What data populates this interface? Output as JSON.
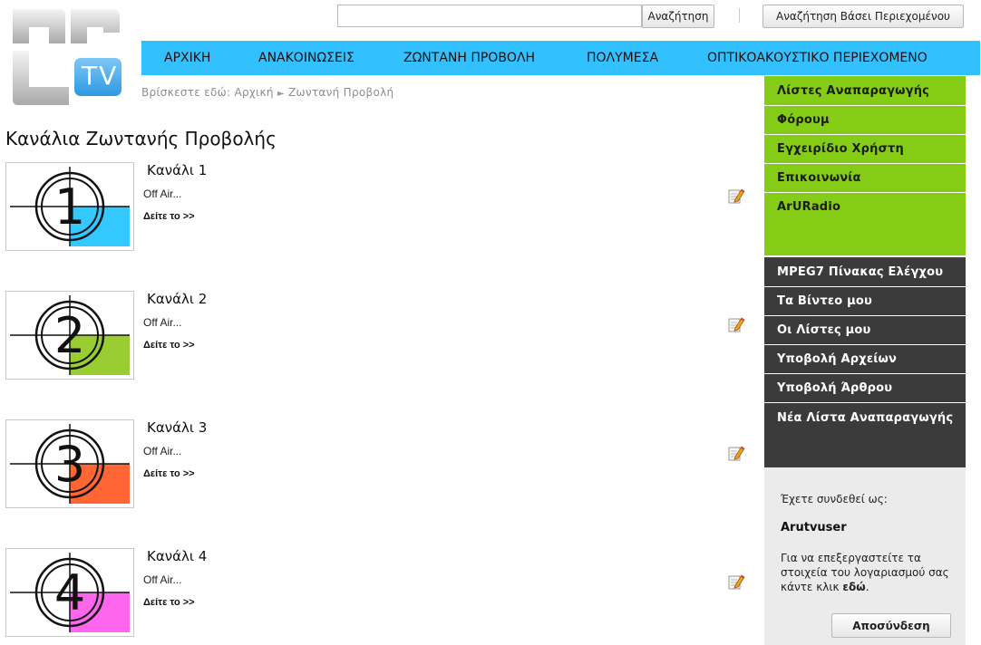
{
  "logo": {
    "text": "TV",
    "accent_color": "#3aa8ee"
  },
  "search": {
    "placeholder": "",
    "button_label": "Αναζήτηση"
  },
  "content_search": {
    "button_label": "Αναζήτηση Βάσει Περιεχομένου"
  },
  "nav": {
    "items": [
      {
        "label": "ΑΡΧΙΚΗ"
      },
      {
        "label": "ΑΝΑΚΟΙΝΩΣΕΙΣ"
      },
      {
        "label": "ΖΩΝΤΑΝΗ ΠΡΟΒΟΛΗ"
      },
      {
        "label": "ΠΟΛΥΜΕΣΑ"
      },
      {
        "label": "ΟΠΤΙΚΟΑΚΟΥΣΤΙΚΟ ΠΕΡΙΕΧΟΜΕΝΟ"
      }
    ],
    "background": "#33c0ff"
  },
  "breadcrumb": {
    "prefix": "Βρίσκεστε εδώ:",
    "home": "Αρχική",
    "separator": "►",
    "current": "Ζωντανή Προβολή"
  },
  "page_title": "Κανάλια Ζωντανής Προβολής",
  "channels": [
    {
      "number": "1",
      "name": "Κανάλι 1",
      "status": "Off Air...",
      "link": "Δείτε το >>",
      "color": "#33c8ff"
    },
    {
      "number": "2",
      "name": "Κανάλι 2",
      "status": "Off Air...",
      "link": "Δείτε το >>",
      "color": "#9acd32"
    },
    {
      "number": "3",
      "name": "Κανάλι 3",
      "status": "Off Air...",
      "link": "Δείτε το >>",
      "color": "#ff6633"
    },
    {
      "number": "4",
      "name": "Κανάλι 4",
      "status": "Off Air...",
      "link": "Δείτε το >>",
      "color": "#ff66ee"
    }
  ],
  "sidebar": {
    "green_items": [
      {
        "label": "Λίστες Αναπαραγωγής"
      },
      {
        "label": "Φόρουμ"
      },
      {
        "label": "Εγχειρίδιο Χρήστη"
      },
      {
        "label": "Επικοινωνία"
      },
      {
        "label": "ArURadio"
      }
    ],
    "dark_items": [
      {
        "label": "MPEG7 Πίνακας Ελέγχου"
      },
      {
        "label": "Τα Βίντεο μου"
      },
      {
        "label": "Οι Λίστες μου"
      },
      {
        "label": "Υποβολή Αρχείων"
      },
      {
        "label": "Υποβολή Άρθρου"
      },
      {
        "label": "Νέα Λίστα Αναπαραγωγής"
      }
    ],
    "green_color": "#84cc16",
    "dark_color": "#3b3b3b"
  },
  "login": {
    "label": "Έχετε συνδεθεί ως:",
    "username": "Arutvuser",
    "text_before": "Για να επεξεργαστείτε τα στοιχεία του λογαριασμού σας κάντε κλικ ",
    "link": "εδώ",
    "text_after": ".",
    "logout_label": "Αποσύνδεση"
  }
}
